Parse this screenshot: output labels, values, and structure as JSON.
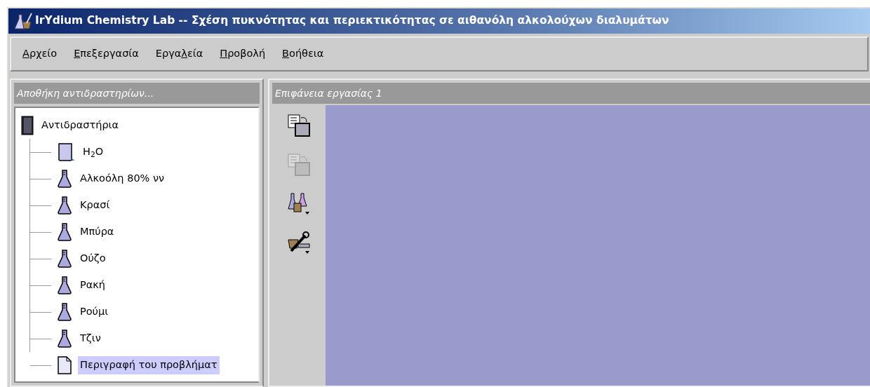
{
  "window": {
    "title": "IrYdium Chemistry Lab -- Σχέση πυκνότητας και περιεκτικότητας σε αιθανόλη αλκολούχων διαλυμάτων"
  },
  "menu": [
    {
      "key": "Α",
      "after": "ρχείο"
    },
    {
      "key": "Ε",
      "after": "πεξεργασία"
    },
    {
      "before": "Εργα",
      "key": "λ",
      "after": "εία"
    },
    {
      "key": "Π",
      "after": "ροβολή"
    },
    {
      "key": "Β",
      "after": "οήθεια"
    }
  ],
  "stockroom": {
    "title": "Αποθήκη αντιδραστηρίων...",
    "tree": {
      "label": "Αντιδραστήρια",
      "kind": "cabinet",
      "selected": false,
      "children": [
        {
          "label": "H$_{2}$O",
          "kind": "beaker",
          "selected": false
        },
        {
          "label": "Αλκοόλη 80% νν",
          "kind": "flask",
          "selected": false
        },
        {
          "label": "Κρασί",
          "kind": "flask",
          "selected": false
        },
        {
          "label": "Μπύρα",
          "kind": "flask",
          "selected": false
        },
        {
          "label": "Ούζο",
          "kind": "flask",
          "selected": false
        },
        {
          "label": "Ρακή",
          "kind": "flask",
          "selected": false
        },
        {
          "label": "Ρούμι",
          "kind": "flask",
          "selected": false
        },
        {
          "label": "Τζιν",
          "kind": "flask",
          "selected": false
        },
        {
          "label": "Περιγραφή του προβλήματ",
          "kind": "document",
          "selected": true
        }
      ]
    }
  },
  "workbench": {
    "title": "Επιφάνεια εργασίας 1",
    "toolbar": [
      {
        "kind": "copy",
        "disabled": false
      },
      {
        "kind": "paste",
        "disabled": true
      },
      {
        "kind": "glassware",
        "disabled": false
      },
      {
        "kind": "tools",
        "disabled": false
      }
    ]
  }
}
